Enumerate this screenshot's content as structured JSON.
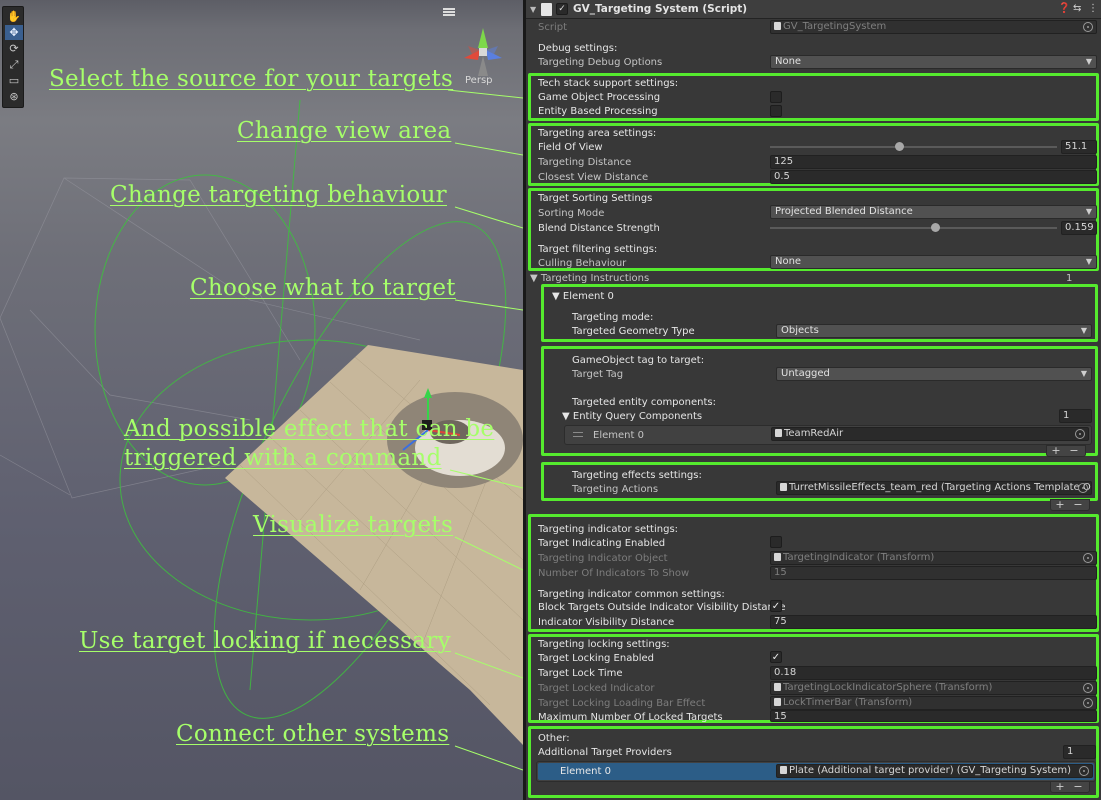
{
  "annotations": {
    "source": "Select the source for your targets",
    "view_area": "Change view area",
    "behaviour": "Change targeting behaviour",
    "what": "Choose what to target",
    "effect_line1": "And possible effect that can be",
    "effect_line2": "triggered with a command",
    "visualize": "Visualize targets",
    "locking": "Use target locking if necessary",
    "connect": "Connect other systems"
  },
  "scene": {
    "persp_label": "Persp",
    "tools": [
      "hand-tool-icon",
      "move-tool-icon",
      "rotate-tool-icon",
      "scale-tool-icon",
      "rect-tool-icon",
      "transform-tool-icon"
    ]
  },
  "inspector": {
    "title": "GV_Targeting System (Script)",
    "script_label": "Script",
    "script_value": "GV_TargetingSystem",
    "debug": {
      "header": "Debug settings:",
      "options_label": "Targeting Debug Options",
      "options_value": "None"
    },
    "tech": {
      "header": "Tech stack support settings:",
      "go_label": "Game Object Processing",
      "entity_label": "Entity Based Processing"
    },
    "area": {
      "header": "Targeting area settings:",
      "fov_label": "Field Of View",
      "fov_value": "51.1",
      "fov_fraction": 0.45,
      "dist_label": "Targeting Distance",
      "dist_value": "125",
      "closest_label": "Closest View Distance",
      "closest_value": "0.5"
    },
    "sorting": {
      "header": "Target Sorting Settings",
      "mode_label": "Sorting Mode",
      "mode_value": "Projected Blended Distance",
      "blend_label": "Blend Distance Strength",
      "blend_value": "0.159",
      "blend_fraction": 0.58,
      "filter_header": "Target filtering settings:",
      "culling_label": "Culling Behaviour",
      "culling_value": "None"
    },
    "instructions": {
      "label": "Targeting Instructions",
      "count": "1",
      "element_label": "Element 0",
      "mode_header": "Targeting mode:",
      "geom_label": "Targeted Geometry Type",
      "geom_value": "Objects",
      "tag_header": "GameObject tag to target:",
      "tag_label": "Target Tag",
      "tag_value": "Untagged",
      "entity_header": "Targeted entity components:",
      "query_label": "Entity Query Components",
      "query_count": "1",
      "query_element_label": "Element 0",
      "query_element_value": "TeamRedAir",
      "effects_header": "Targeting effects settings:",
      "actions_label": "Targeting Actions",
      "actions_value": "TurretMissileEffects_team_red (Targeting Actions Template Object)"
    },
    "indicator": {
      "header": "Targeting indicator settings:",
      "enabled_label": "Target Indicating Enabled",
      "object_label": "Targeting Indicator Object",
      "object_value": "TargetingIndicator (Transform)",
      "count_label": "Number Of Indicators To Show",
      "count_value": "15",
      "common_header": "Targeting indicator common settings:",
      "block_label": "Block Targets Outside Indicator Visibility Distance",
      "vis_label": "Indicator Visibility Distance",
      "vis_value": "75"
    },
    "locking": {
      "header": "Targeting locking settings:",
      "enabled_label": "Target Locking Enabled",
      "time_label": "Target Lock Time",
      "time_value": "0.18",
      "indicator_label": "Target Locked Indicator",
      "indicator_value": "TargetingLockIndicatorSphere (Transform)",
      "bar_label": "Target Locking Loading Bar Effect",
      "bar_value": "LockTimerBar (Transform)",
      "max_label": "Maximum Number Of Locked Targets",
      "max_value": "15"
    },
    "other": {
      "header": "Other:",
      "providers_label": "Additional Target Providers",
      "providers_count": "1",
      "element_label": "Element 0",
      "element_value": "Plate (Additional target provider) (GV_Targeting System)"
    },
    "checkmark": "✓",
    "plus": "+",
    "minus": "−"
  },
  "colors": {
    "highlight": "#55ea2e",
    "annotation_text": "#a6ff6a",
    "selection": "#2c5d87"
  }
}
